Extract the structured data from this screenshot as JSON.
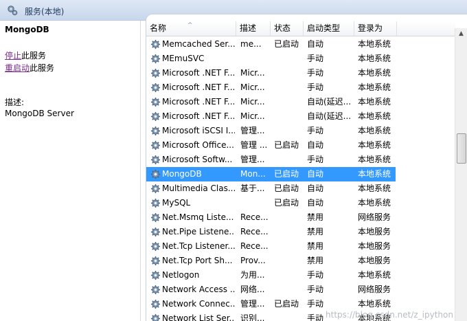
{
  "window": {
    "title": "服务(本地)"
  },
  "left_pane": {
    "service_name": "MongoDB",
    "actions": [
      {
        "link": "停止",
        "rest": "此服务"
      },
      {
        "link": "重启动",
        "rest": "此服务"
      }
    ],
    "description_label": "描述:",
    "description": "MongoDB Server"
  },
  "columns": [
    "名称",
    "描述",
    "状态",
    "启动类型",
    "登录为"
  ],
  "rows": [
    {
      "name": "Memcached Ser...",
      "desc": "me...",
      "status": "已启动",
      "startup": "自动",
      "logon": "本地系统"
    },
    {
      "name": "MEmuSVC",
      "desc": "",
      "status": "",
      "startup": "手动",
      "logon": "本地系统"
    },
    {
      "name": "Microsoft .NET F...",
      "desc": "Micr...",
      "status": "",
      "startup": "手动",
      "logon": "本地系统"
    },
    {
      "name": "Microsoft .NET F...",
      "desc": "Micr...",
      "status": "",
      "startup": "手动",
      "logon": "本地系统"
    },
    {
      "name": "Microsoft .NET F...",
      "desc": "Micr...",
      "status": "",
      "startup": "自动(延迟...",
      "logon": "本地系统"
    },
    {
      "name": "Microsoft .NET F...",
      "desc": "Micr...",
      "status": "",
      "startup": "自动(延迟...",
      "logon": "本地系统"
    },
    {
      "name": "Microsoft iSCSI I...",
      "desc": "管理...",
      "status": "",
      "startup": "手动",
      "logon": "本地系统"
    },
    {
      "name": "Microsoft Office...",
      "desc": "管理 ...",
      "status": "已启动",
      "startup": "自动",
      "logon": "本地系统"
    },
    {
      "name": "Microsoft Softw...",
      "desc": "管理...",
      "status": "",
      "startup": "手动",
      "logon": "本地系统"
    },
    {
      "name": "MongoDB",
      "desc": "Mon...",
      "status": "已启动",
      "startup": "自动",
      "logon": "本地系统",
      "selected": true
    },
    {
      "name": "Multimedia Clas...",
      "desc": "基于...",
      "status": "已启动",
      "startup": "自动",
      "logon": "本地系统"
    },
    {
      "name": "MySQL",
      "desc": "",
      "status": "已启动",
      "startup": "自动",
      "logon": "本地系统"
    },
    {
      "name": "Net.Msmq Liste...",
      "desc": "Rece...",
      "status": "",
      "startup": "禁用",
      "logon": "网络服务"
    },
    {
      "name": "Net.Pipe Listene...",
      "desc": "Rece...",
      "status": "",
      "startup": "禁用",
      "logon": "本地服务"
    },
    {
      "name": "Net.Tcp Listener...",
      "desc": "Rece...",
      "status": "",
      "startup": "禁用",
      "logon": "本地服务"
    },
    {
      "name": "Net.Tcp Port Sh...",
      "desc": "Prov...",
      "status": "",
      "startup": "禁用",
      "logon": "本地服务"
    },
    {
      "name": "Netlogon",
      "desc": "为用...",
      "status": "",
      "startup": "手动",
      "logon": "本地系统"
    },
    {
      "name": "Network Access ...",
      "desc": "网络...",
      "status": "",
      "startup": "手动",
      "logon": "网络服务"
    },
    {
      "name": "Network Connec...",
      "desc": "管理...",
      "status": "已启动",
      "startup": "手动",
      "logon": "本地系统"
    },
    {
      "name": "Network List Ser...",
      "desc": "识别...",
      "status": "",
      "startup": "手动",
      "logon": "本地系统"
    }
  ],
  "watermark": "https://blog.csdn.net/z_ipython",
  "colors": {
    "selection": "#3399ff",
    "link": "#7a2a8a"
  }
}
